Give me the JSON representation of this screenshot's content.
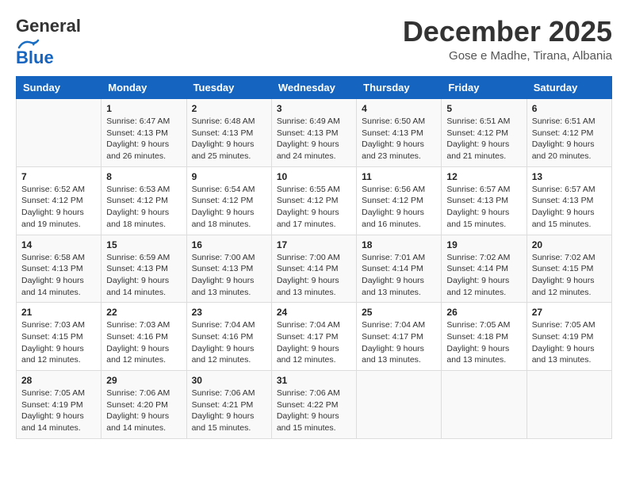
{
  "header": {
    "logo_line1": "General",
    "logo_line2": "Blue",
    "month": "December 2025",
    "location": "Gose e Madhe, Tirana, Albania"
  },
  "weekdays": [
    "Sunday",
    "Monday",
    "Tuesday",
    "Wednesday",
    "Thursday",
    "Friday",
    "Saturday"
  ],
  "weeks": [
    [
      {
        "day": "",
        "sunrise": "",
        "sunset": "",
        "daylight": ""
      },
      {
        "day": "1",
        "sunrise": "6:47 AM",
        "sunset": "4:13 PM",
        "daylight": "9 hours and 26 minutes."
      },
      {
        "day": "2",
        "sunrise": "6:48 AM",
        "sunset": "4:13 PM",
        "daylight": "9 hours and 25 minutes."
      },
      {
        "day": "3",
        "sunrise": "6:49 AM",
        "sunset": "4:13 PM",
        "daylight": "9 hours and 24 minutes."
      },
      {
        "day": "4",
        "sunrise": "6:50 AM",
        "sunset": "4:13 PM",
        "daylight": "9 hours and 23 minutes."
      },
      {
        "day": "5",
        "sunrise": "6:51 AM",
        "sunset": "4:12 PM",
        "daylight": "9 hours and 21 minutes."
      },
      {
        "day": "6",
        "sunrise": "6:51 AM",
        "sunset": "4:12 PM",
        "daylight": "9 hours and 20 minutes."
      }
    ],
    [
      {
        "day": "7",
        "sunrise": "6:52 AM",
        "sunset": "4:12 PM",
        "daylight": "9 hours and 19 minutes."
      },
      {
        "day": "8",
        "sunrise": "6:53 AM",
        "sunset": "4:12 PM",
        "daylight": "9 hours and 18 minutes."
      },
      {
        "day": "9",
        "sunrise": "6:54 AM",
        "sunset": "4:12 PM",
        "daylight": "9 hours and 18 minutes."
      },
      {
        "day": "10",
        "sunrise": "6:55 AM",
        "sunset": "4:12 PM",
        "daylight": "9 hours and 17 minutes."
      },
      {
        "day": "11",
        "sunrise": "6:56 AM",
        "sunset": "4:12 PM",
        "daylight": "9 hours and 16 minutes."
      },
      {
        "day": "12",
        "sunrise": "6:57 AM",
        "sunset": "4:13 PM",
        "daylight": "9 hours and 15 minutes."
      },
      {
        "day": "13",
        "sunrise": "6:57 AM",
        "sunset": "4:13 PM",
        "daylight": "9 hours and 15 minutes."
      }
    ],
    [
      {
        "day": "14",
        "sunrise": "6:58 AM",
        "sunset": "4:13 PM",
        "daylight": "9 hours and 14 minutes."
      },
      {
        "day": "15",
        "sunrise": "6:59 AM",
        "sunset": "4:13 PM",
        "daylight": "9 hours and 14 minutes."
      },
      {
        "day": "16",
        "sunrise": "7:00 AM",
        "sunset": "4:13 PM",
        "daylight": "9 hours and 13 minutes."
      },
      {
        "day": "17",
        "sunrise": "7:00 AM",
        "sunset": "4:14 PM",
        "daylight": "9 hours and 13 minutes."
      },
      {
        "day": "18",
        "sunrise": "7:01 AM",
        "sunset": "4:14 PM",
        "daylight": "9 hours and 13 minutes."
      },
      {
        "day": "19",
        "sunrise": "7:02 AM",
        "sunset": "4:14 PM",
        "daylight": "9 hours and 12 minutes."
      },
      {
        "day": "20",
        "sunrise": "7:02 AM",
        "sunset": "4:15 PM",
        "daylight": "9 hours and 12 minutes."
      }
    ],
    [
      {
        "day": "21",
        "sunrise": "7:03 AM",
        "sunset": "4:15 PM",
        "daylight": "9 hours and 12 minutes."
      },
      {
        "day": "22",
        "sunrise": "7:03 AM",
        "sunset": "4:16 PM",
        "daylight": "9 hours and 12 minutes."
      },
      {
        "day": "23",
        "sunrise": "7:04 AM",
        "sunset": "4:16 PM",
        "daylight": "9 hours and 12 minutes."
      },
      {
        "day": "24",
        "sunrise": "7:04 AM",
        "sunset": "4:17 PM",
        "daylight": "9 hours and 12 minutes."
      },
      {
        "day": "25",
        "sunrise": "7:04 AM",
        "sunset": "4:17 PM",
        "daylight": "9 hours and 13 minutes."
      },
      {
        "day": "26",
        "sunrise": "7:05 AM",
        "sunset": "4:18 PM",
        "daylight": "9 hours and 13 minutes."
      },
      {
        "day": "27",
        "sunrise": "7:05 AM",
        "sunset": "4:19 PM",
        "daylight": "9 hours and 13 minutes."
      }
    ],
    [
      {
        "day": "28",
        "sunrise": "7:05 AM",
        "sunset": "4:19 PM",
        "daylight": "9 hours and 14 minutes."
      },
      {
        "day": "29",
        "sunrise": "7:06 AM",
        "sunset": "4:20 PM",
        "daylight": "9 hours and 14 minutes."
      },
      {
        "day": "30",
        "sunrise": "7:06 AM",
        "sunset": "4:21 PM",
        "daylight": "9 hours and 15 minutes."
      },
      {
        "day": "31",
        "sunrise": "7:06 AM",
        "sunset": "4:22 PM",
        "daylight": "9 hours and 15 minutes."
      },
      {
        "day": "",
        "sunrise": "",
        "sunset": "",
        "daylight": ""
      },
      {
        "day": "",
        "sunrise": "",
        "sunset": "",
        "daylight": ""
      },
      {
        "day": "",
        "sunrise": "",
        "sunset": "",
        "daylight": ""
      }
    ]
  ],
  "labels": {
    "sunrise_prefix": "Sunrise: ",
    "sunset_prefix": "Sunset: ",
    "daylight_prefix": "Daylight: "
  }
}
